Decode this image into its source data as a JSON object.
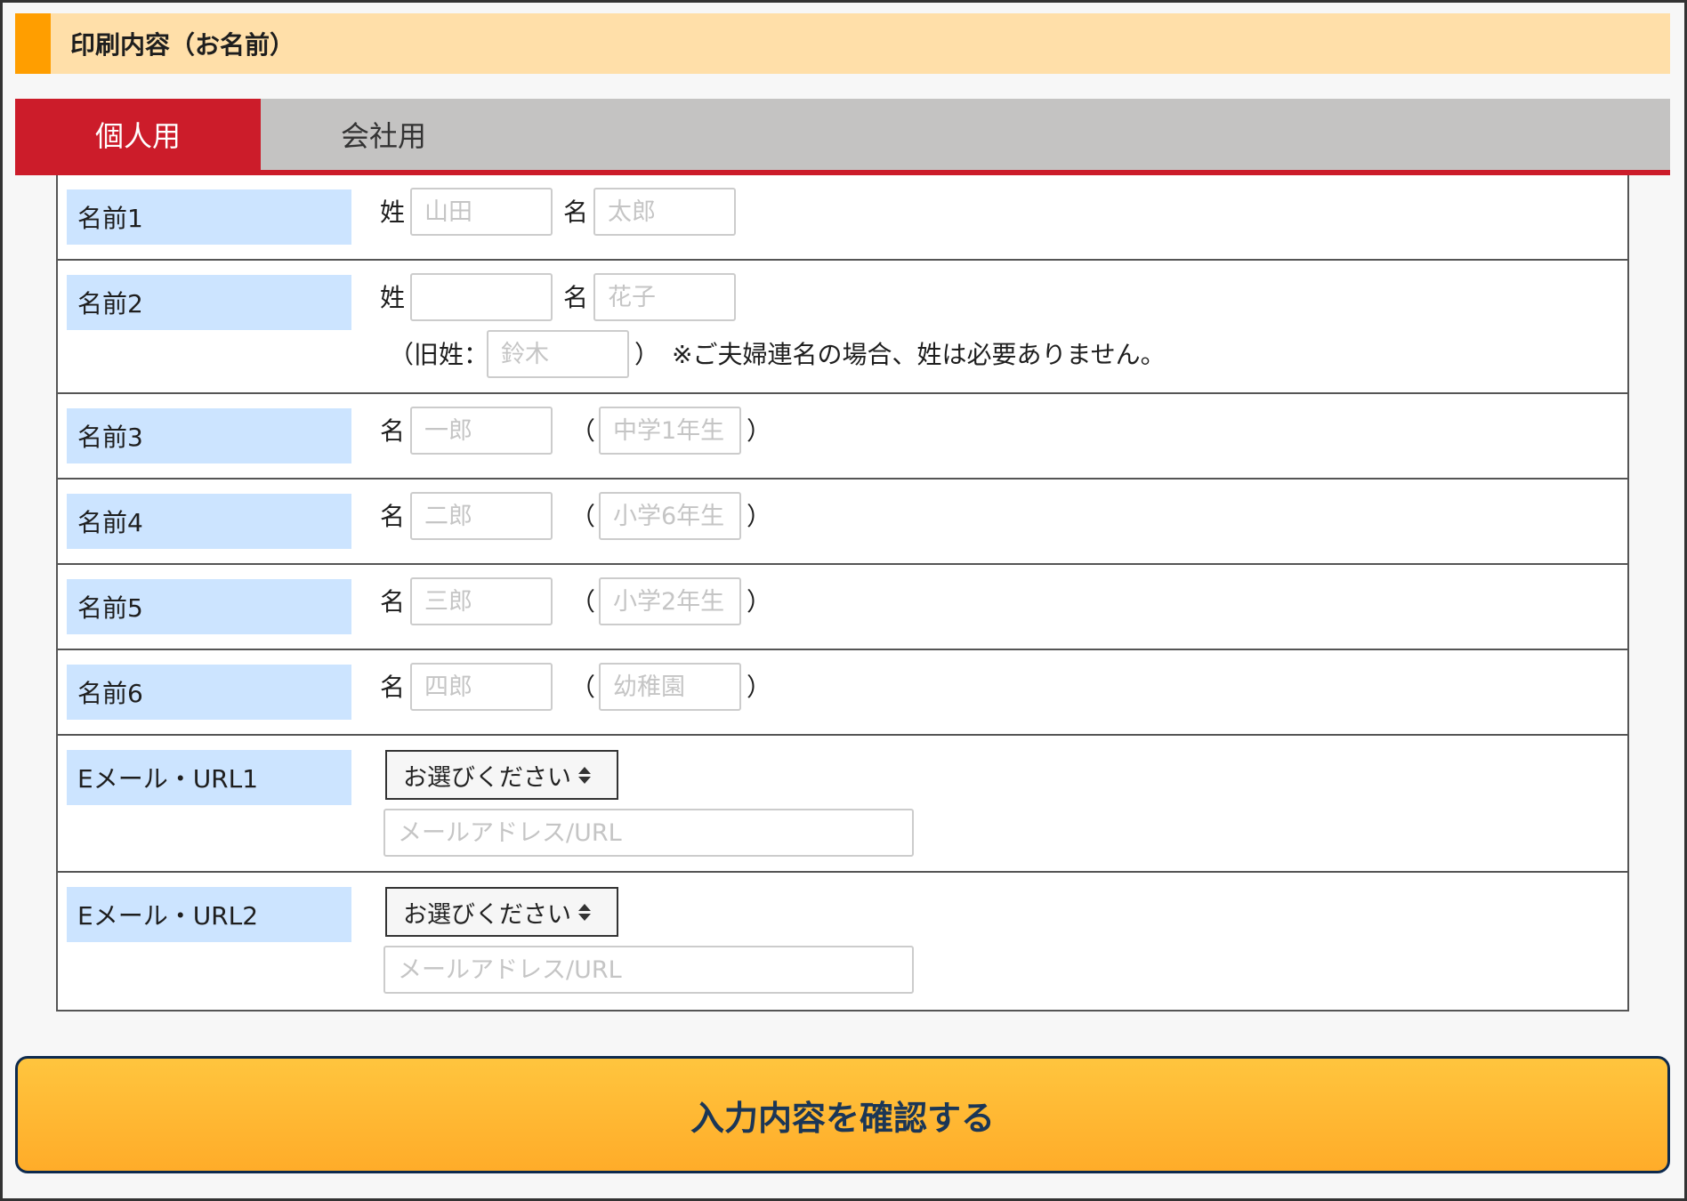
{
  "section": {
    "title": "印刷内容（お名前）"
  },
  "tabs": [
    {
      "label": "個人用",
      "active": true
    },
    {
      "label": "会社用",
      "active": false
    }
  ],
  "rows": [
    {
      "label": "名前1",
      "sei_label": "姓",
      "sei_placeholder": "山田",
      "mei_label": "名",
      "mei_placeholder": "太郎"
    },
    {
      "label": "名前2",
      "sei_label": "姓",
      "sei_placeholder": "",
      "mei_label": "名",
      "mei_placeholder": "花子",
      "kyusei_open": "（旧姓：",
      "kyusei_placeholder": "鈴木",
      "kyusei_close": "）",
      "note": "※ご夫婦連名の場合、姓は必要ありません。"
    },
    {
      "label": "名前3",
      "mei_label": "名",
      "mei_placeholder": "一郎",
      "paren_open": "（",
      "grade_placeholder": "中学1年生",
      "paren_close": "）"
    },
    {
      "label": "名前4",
      "mei_label": "名",
      "mei_placeholder": "二郎",
      "paren_open": "（",
      "grade_placeholder": "小学6年生",
      "paren_close": "）"
    },
    {
      "label": "名前5",
      "mei_label": "名",
      "mei_placeholder": "三郎",
      "paren_open": "（",
      "grade_placeholder": "小学2年生",
      "paren_close": "）"
    },
    {
      "label": "名前6",
      "mei_label": "名",
      "mei_placeholder": "四郎",
      "paren_open": "（",
      "grade_placeholder": "幼稚園",
      "paren_close": "）"
    },
    {
      "label": "Eメール・URL1",
      "select_value": "お選びください",
      "url_placeholder": "メールアドレス/URL"
    },
    {
      "label": "Eメール・URL2",
      "select_value": "お選びください",
      "url_placeholder": "メールアドレス/URL"
    }
  ],
  "confirm": {
    "label": "入力内容を確認する"
  },
  "colors": {
    "header_bg": "#ffdfa9",
    "header_accent": "#ff9e00",
    "tab_active": "#cc1c2a",
    "tab_inactive": "#c4c3c2",
    "label_bg": "#cce4ff",
    "button_bg": "#ffb733",
    "button_text": "#1b3656"
  },
  "icons": {
    "select_arrow": "up-down-arrows-icon"
  }
}
